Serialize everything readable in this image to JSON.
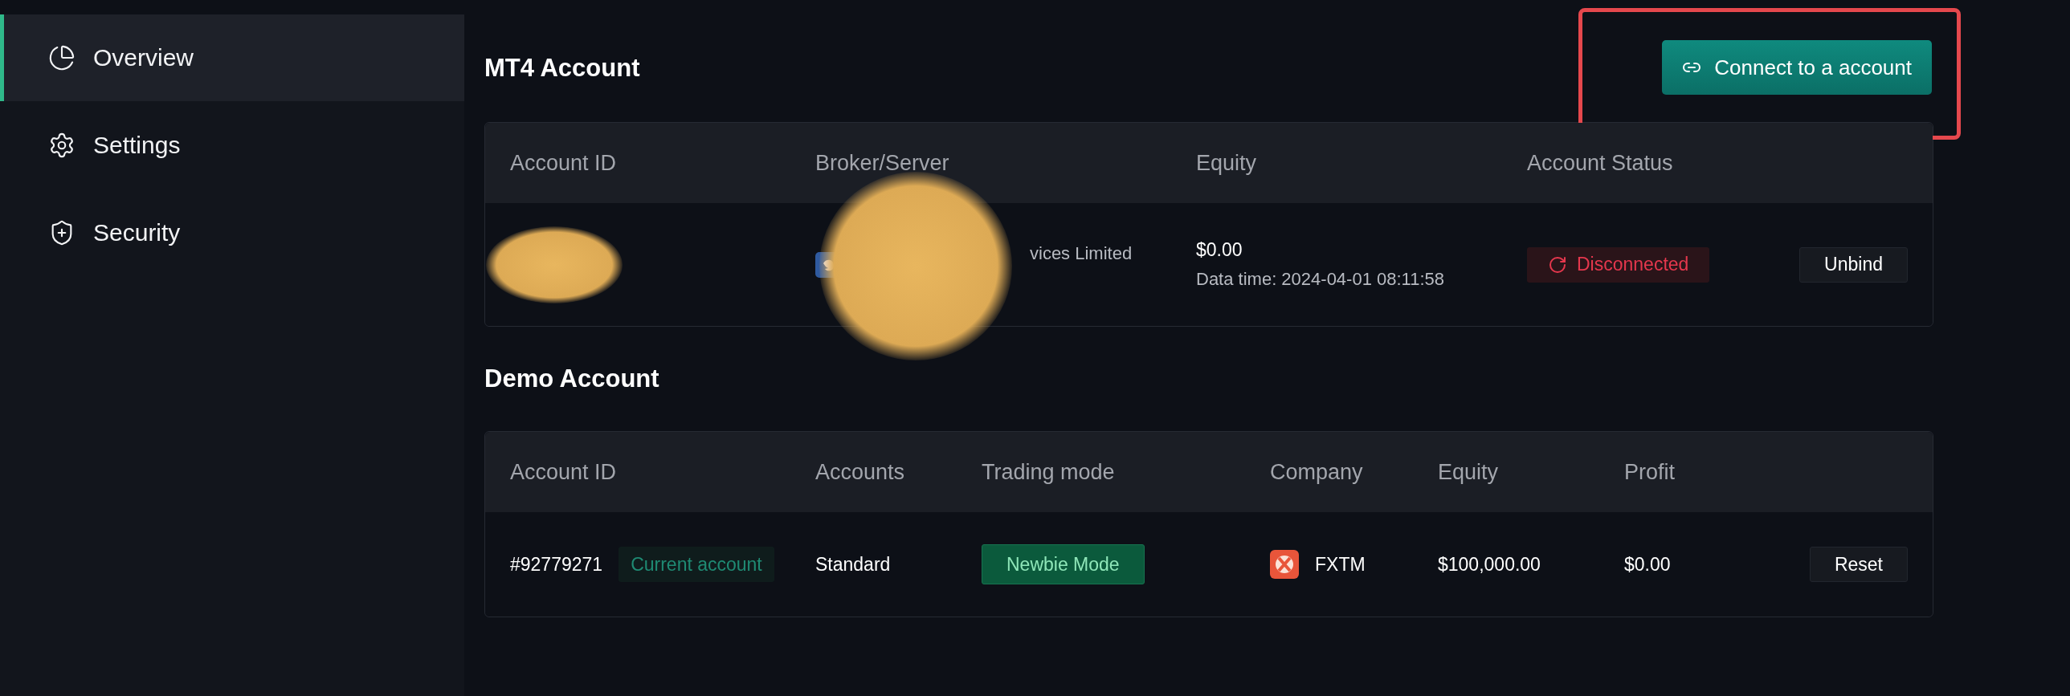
{
  "sidebar": {
    "items": [
      {
        "label": "Overview",
        "selected": true
      },
      {
        "label": "Settings",
        "selected": false
      },
      {
        "label": "Security",
        "selected": false
      }
    ]
  },
  "mt4": {
    "title": "MT4 Account",
    "connect_button": {
      "label": "Connect to a account",
      "highlighted": true
    },
    "columns": [
      "Account ID",
      "Broker/Server",
      "Equity",
      "Account Status"
    ],
    "rows": [
      {
        "account_id": {
          "redacted": true
        },
        "broker": {
          "name": "vices Limited",
          "redacted": true
        },
        "equity": "$0.00",
        "data_time": "Data time: 2024-04-01 08:11:58",
        "status": {
          "label": "Disconnected",
          "connected": false
        },
        "action": "Unbind"
      }
    ]
  },
  "demo": {
    "title": "Demo Account",
    "columns": [
      "Account ID",
      "Accounts",
      "Trading mode",
      "Company",
      "Equity",
      "Profit"
    ],
    "rows": [
      {
        "account_id": "#92779271",
        "badge": "Current account",
        "accounts": "Standard",
        "mode": "Newbie Mode",
        "company": "FXTM",
        "equity": "$100,000.00",
        "profit": "$0.00",
        "action": "Reset"
      }
    ]
  }
}
